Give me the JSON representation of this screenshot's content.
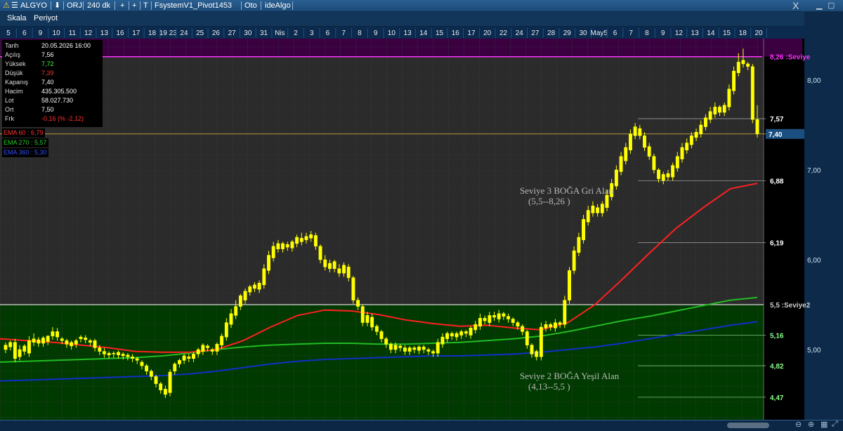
{
  "window": {
    "symbol": "ALGYO",
    "mode": "ORJ",
    "interval": "240 dk",
    "plus": "+",
    "pin": "T",
    "strategy": "FsystemV1_Pivot1453",
    "auto": "Oto",
    "provider": "ideAlgo",
    "close_glyph": "X"
  },
  "toolbar": {
    "scale": "Skala",
    "period": "Periyot"
  },
  "date_axis": [
    "5",
    "6",
    "9",
    "10",
    "11",
    "12",
    "13",
    "16",
    "17",
    "18",
    "19 23",
    "24",
    "25",
    "26",
    "27",
    "30",
    "31",
    "Nis",
    "2",
    "3",
    "6",
    "7",
    "8",
    "9",
    "10",
    "13",
    "14",
    "15",
    "16",
    "17",
    "20",
    "22",
    "24",
    "27",
    "28",
    "29",
    "30",
    "May5",
    "6",
    "7",
    "8",
    "9",
    "12",
    "13",
    "14",
    "15",
    "18",
    "20"
  ],
  "info": {
    "date_label": "Tarih",
    "date_value": "20.05.2026 16:00",
    "open_label": "Açılış",
    "open_value": "7,56",
    "high_label": "Yüksek",
    "high_value": "7,72",
    "low_label": "Düşük",
    "low_value": "7,39",
    "close_label": "Kapanış",
    "close_value": "7,40",
    "volume_label": "Hacim",
    "volume_value": "435.305.500",
    "lot_label": "Lot",
    "lot_value": "58.027.730",
    "avg_label": "Ort",
    "avg_value": "7,50",
    "diff_label": "Frk",
    "diff_value": "-0,16 (% -2,12)"
  },
  "ema_labels": {
    "ema60": "EMA 60 : 6,79",
    "ema270": "EMA 270 : 5,57",
    "ema360": "EMA 360 : 5,30"
  },
  "colors": {
    "candle": "#ffff00",
    "ema60": "#ff2020",
    "ema270": "#22bb22",
    "ema360": "#1030c8",
    "green_zone": "#003a00",
    "magenta_zone": "#3a0040",
    "price_tag": "#1b4f80"
  },
  "chart_data": {
    "type": "candlestick",
    "y_ticks": [
      "8,00",
      "7,00",
      "6,00",
      "5,00"
    ],
    "ylim": [
      4.4,
      8.45
    ],
    "last_price": "7,40",
    "levels": [
      {
        "label": "8,26 :Seviye",
        "value": 8.26,
        "color": "#ff33ff"
      },
      {
        "label": "7,57",
        "value": 7.57,
        "color": "#ffffff"
      },
      {
        "label": "6,88",
        "value": 6.88,
        "color": "#ffffff"
      },
      {
        "label": "6,19",
        "value": 6.19,
        "color": "#ffffff"
      },
      {
        "label": "5,5 :Seviye2",
        "value": 5.5,
        "color": "#cccccc"
      },
      {
        "label": "5,16",
        "value": 5.16,
        "color": "#88ff88"
      },
      {
        "label": "4,82",
        "value": 4.82,
        "color": "#88ff88"
      },
      {
        "label": "4,47",
        "value": 4.47,
        "color": "#88ff88"
      }
    ],
    "zones": [
      {
        "title": "Seviye 3 BOĞA Gri Alan",
        "range": "(5,5--8,26 )"
      },
      {
        "title": "Seviye 2 BOĞA Yeşil Alan",
        "range": "(4,13--5,5 )"
      }
    ],
    "candles": [
      [
        5.05,
        5.0,
        5.08
      ],
      [
        5.08,
        5.03,
        5.1
      ],
      [
        4.9,
        5.08,
        5.12
      ],
      [
        5.0,
        4.92,
        5.05
      ],
      [
        4.98,
        5.04,
        5.06
      ],
      [
        5.1,
        4.96,
        5.15
      ],
      [
        5.12,
        5.08,
        5.18
      ],
      [
        5.07,
        5.11,
        5.14
      ],
      [
        5.13,
        5.07,
        5.15
      ],
      [
        5.15,
        5.09,
        5.16
      ],
      [
        5.2,
        5.15,
        5.25
      ],
      [
        5.14,
        5.2,
        5.24
      ],
      [
        5.1,
        5.12,
        5.14
      ],
      [
        5.06,
        5.1,
        5.12
      ],
      [
        5.08,
        5.04,
        5.1
      ],
      [
        5.1,
        5.06,
        5.12
      ],
      [
        5.14,
        5.12,
        5.16
      ],
      [
        5.11,
        5.13,
        5.16
      ],
      [
        5.1,
        5.08,
        5.12
      ],
      [
        5.02,
        5.1,
        5.12
      ],
      [
        4.98,
        5.02,
        5.05
      ],
      [
        4.95,
        4.98,
        5.02
      ],
      [
        4.96,
        4.94,
        4.98
      ],
      [
        4.95,
        4.96,
        4.98
      ],
      [
        4.94,
        4.97,
        4.99
      ],
      [
        4.93,
        4.95,
        4.97
      ],
      [
        4.92,
        4.94,
        4.96
      ],
      [
        4.9,
        4.92,
        4.95
      ],
      [
        4.88,
        4.9,
        4.92
      ],
      [
        4.82,
        4.86,
        4.88
      ],
      [
        4.76,
        4.82,
        4.84
      ],
      [
        4.7,
        4.76,
        4.78
      ],
      [
        4.62,
        4.7,
        4.72
      ],
      [
        4.55,
        4.62,
        4.64
      ],
      [
        4.5,
        4.56,
        4.6
      ],
      [
        4.75,
        4.52,
        4.78
      ],
      [
        4.84,
        4.76,
        4.86
      ],
      [
        4.88,
        4.84,
        4.9
      ],
      [
        4.93,
        4.88,
        4.95
      ],
      [
        4.9,
        4.92,
        4.95
      ],
      [
        4.95,
        4.9,
        4.97
      ],
      [
        5.0,
        4.95,
        5.02
      ],
      [
        5.05,
        4.98,
        5.07
      ],
      [
        5.02,
        5.04,
        5.06
      ],
      [
        4.98,
        5.0,
        5.02
      ],
      [
        5.06,
        4.98,
        5.08
      ],
      [
        5.15,
        5.05,
        5.18
      ],
      [
        5.3,
        5.14,
        5.35
      ],
      [
        5.4,
        5.28,
        5.45
      ],
      [
        5.48,
        5.38,
        5.55
      ],
      [
        5.6,
        5.48,
        5.62
      ],
      [
        5.65,
        5.55,
        5.68
      ],
      [
        5.7,
        5.64,
        5.72
      ],
      [
        5.68,
        5.72,
        5.75
      ],
      [
        5.74,
        5.67,
        5.77
      ],
      [
        5.9,
        5.72,
        5.95
      ],
      [
        6.05,
        5.88,
        6.1
      ],
      [
        6.15,
        6.02,
        6.2
      ],
      [
        6.12,
        6.18,
        6.22
      ],
      [
        6.18,
        6.12,
        6.2
      ],
      [
        6.14,
        6.17,
        6.2
      ],
      [
        6.2,
        6.13,
        6.22
      ],
      [
        6.25,
        6.18,
        6.28
      ],
      [
        6.2,
        6.24,
        6.3
      ],
      [
        6.26,
        6.22,
        6.3
      ],
      [
        6.28,
        6.24,
        6.32
      ],
      [
        6.15,
        6.27,
        6.3
      ],
      [
        6.0,
        6.15,
        6.17
      ],
      [
        5.92,
        6.0,
        6.05
      ],
      [
        5.96,
        5.9,
        6.0
      ],
      [
        5.9,
        5.98,
        6.0
      ],
      [
        5.85,
        5.9,
        5.95
      ],
      [
        5.94,
        5.85,
        5.97
      ],
      [
        5.8,
        5.92,
        5.95
      ],
      [
        5.55,
        5.8,
        5.82
      ],
      [
        5.48,
        5.55,
        5.58
      ],
      [
        5.3,
        5.48,
        5.5
      ],
      [
        5.38,
        5.3,
        5.42
      ],
      [
        5.25,
        5.36,
        5.4
      ],
      [
        5.2,
        5.26,
        5.28
      ],
      [
        5.12,
        5.2,
        5.22
      ],
      [
        5.06,
        5.12,
        5.14
      ],
      [
        5.0,
        5.06,
        5.08
      ],
      [
        5.05,
        5.0,
        5.08
      ],
      [
        5.02,
        5.04,
        5.06
      ],
      [
        4.98,
        5.02,
        5.05
      ],
      [
        5.02,
        4.98,
        5.04
      ],
      [
        5.0,
        5.02,
        5.04
      ],
      [
        5.03,
        4.99,
        5.05
      ],
      [
        5.0,
        5.03,
        5.05
      ],
      [
        4.98,
        5.0,
        5.02
      ],
      [
        4.96,
        4.98,
        5.0
      ],
      [
        5.08,
        4.96,
        5.12
      ],
      [
        5.14,
        5.06,
        5.18
      ],
      [
        5.18,
        5.12,
        5.2
      ],
      [
        5.15,
        5.18,
        5.2
      ],
      [
        5.18,
        5.14,
        5.2
      ],
      [
        5.2,
        5.16,
        5.22
      ],
      [
        5.18,
        5.2,
        5.22
      ],
      [
        5.24,
        5.16,
        5.26
      ],
      [
        5.28,
        5.22,
        5.32
      ],
      [
        5.35,
        5.26,
        5.4
      ],
      [
        5.32,
        5.35,
        5.38
      ],
      [
        5.38,
        5.3,
        5.42
      ],
      [
        5.36,
        5.38,
        5.42
      ],
      [
        5.4,
        5.34,
        5.44
      ],
      [
        5.37,
        5.4,
        5.42
      ],
      [
        5.34,
        5.37,
        5.4
      ],
      [
        5.3,
        5.34,
        5.36
      ],
      [
        5.26,
        5.3,
        5.32
      ],
      [
        5.2,
        5.26,
        5.28
      ],
      [
        5.05,
        5.2,
        5.22
      ],
      [
        4.95,
        5.05,
        5.07
      ],
      [
        4.92,
        4.98,
        5.0
      ],
      [
        5.25,
        4.92,
        5.3
      ],
      [
        5.28,
        5.24,
        5.32
      ],
      [
        5.25,
        5.28,
        5.3
      ],
      [
        5.3,
        5.24,
        5.34
      ],
      [
        5.28,
        5.3,
        5.32
      ],
      [
        5.55,
        5.28,
        5.6
      ],
      [
        5.88,
        5.55,
        5.92
      ],
      [
        6.1,
        5.88,
        6.15
      ],
      [
        6.25,
        6.08,
        6.3
      ],
      [
        6.45,
        6.22,
        6.5
      ],
      [
        6.55,
        6.42,
        6.6
      ],
      [
        6.6,
        6.52,
        6.65
      ],
      [
        6.52,
        6.58,
        6.62
      ],
      [
        6.62,
        6.52,
        6.65
      ],
      [
        6.72,
        6.58,
        6.78
      ],
      [
        6.85,
        6.7,
        6.9
      ],
      [
        7.0,
        6.82,
        7.05
      ],
      [
        7.15,
        6.98,
        7.2
      ],
      [
        7.25,
        7.1,
        7.3
      ],
      [
        7.4,
        7.22,
        7.45
      ],
      [
        7.48,
        7.38,
        7.52
      ],
      [
        7.38,
        7.46,
        7.5
      ],
      [
        7.25,
        7.38,
        7.42
      ],
      [
        7.15,
        7.26,
        7.3
      ],
      [
        7.0,
        7.15,
        7.18
      ],
      [
        6.9,
        7.0,
        7.02
      ],
      [
        6.95,
        6.88,
        6.98
      ],
      [
        6.92,
        6.96,
        7.0
      ],
      [
        7.05,
        6.92,
        7.08
      ],
      [
        7.15,
        7.02,
        7.2
      ],
      [
        7.25,
        7.12,
        7.3
      ],
      [
        7.3,
        7.22,
        7.35
      ],
      [
        7.38,
        7.28,
        7.42
      ],
      [
        7.42,
        7.36,
        7.46
      ],
      [
        7.5,
        7.4,
        7.55
      ],
      [
        7.58,
        7.48,
        7.62
      ],
      [
        7.65,
        7.56,
        7.7
      ],
      [
        7.7,
        7.62,
        7.75
      ],
      [
        7.64,
        7.7,
        7.72
      ],
      [
        7.72,
        7.64,
        7.75
      ],
      [
        7.9,
        7.7,
        7.95
      ],
      [
        8.1,
        7.88,
        8.15
      ],
      [
        8.2,
        8.08,
        8.3
      ],
      [
        8.18,
        8.22,
        8.35
      ],
      [
        8.15,
        8.18,
        8.2
      ],
      [
        7.56,
        8.15,
        8.18
      ],
      [
        7.4,
        7.56,
        7.72
      ]
    ],
    "ema60": [
      5.12,
      5.1,
      5.08,
      5.05,
      5.02,
      4.98,
      4.97,
      4.97,
      5.0,
      5.1,
      5.25,
      5.38,
      5.44,
      5.43,
      5.39,
      5.33,
      5.29,
      5.26,
      5.27,
      5.24,
      5.22,
      5.3,
      5.5,
      5.78,
      6.07,
      6.35,
      6.58,
      6.79,
      6.85
    ],
    "ema270": [
      4.86,
      4.87,
      4.88,
      4.89,
      4.9,
      4.91,
      4.93,
      4.96,
      5.0,
      5.03,
      5.05,
      5.06,
      5.07,
      5.07,
      5.06,
      5.06,
      5.07,
      5.08,
      5.1,
      5.12,
      5.15,
      5.2,
      5.26,
      5.32,
      5.37,
      5.43,
      5.49,
      5.55,
      5.58
    ],
    "ema360": [
      4.65,
      4.66,
      4.67,
      4.68,
      4.69,
      4.7,
      4.71,
      4.73,
      4.76,
      4.8,
      4.84,
      4.87,
      4.89,
      4.9,
      4.91,
      4.92,
      4.93,
      4.93,
      4.94,
      4.95,
      4.97,
      5.0,
      5.03,
      5.07,
      5.12,
      5.17,
      5.22,
      5.27,
      5.31
    ]
  }
}
